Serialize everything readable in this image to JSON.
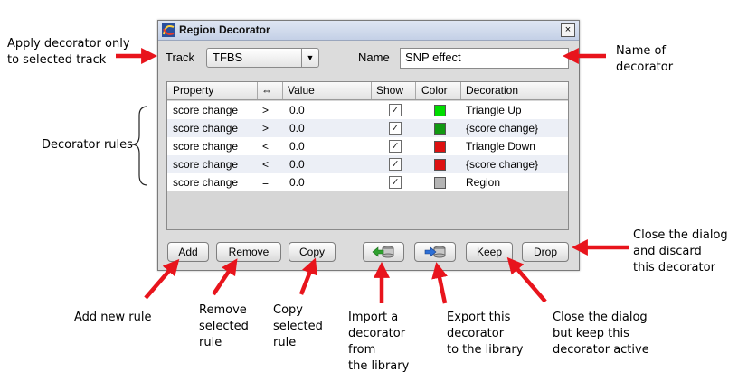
{
  "dialog": {
    "title": "Region Decorator",
    "close_glyph": "×",
    "track_label": "Track",
    "track_value": "TFBS",
    "name_label": "Name",
    "name_value": "SNP effect",
    "dropdown_glyph": "▼"
  },
  "table": {
    "headers": [
      "Property",
      "⇔",
      "Value",
      "Show",
      "Color",
      "Decoration"
    ],
    "rows": [
      {
        "property": "score change",
        "op": ">",
        "value": "0.0",
        "show": "✓",
        "color": "#00dd00",
        "decoration": "Triangle Up"
      },
      {
        "property": "score change",
        "op": ">",
        "value": "0.0",
        "show": "✓",
        "color": "#119911",
        "decoration": "{score change}"
      },
      {
        "property": "score change",
        "op": "<",
        "value": "0.0",
        "show": "✓",
        "color": "#dd1111",
        "decoration": "Triangle Down"
      },
      {
        "property": "score change",
        "op": "<",
        "value": "0.0",
        "show": "✓",
        "color": "#dd1111",
        "decoration": "{score change}"
      },
      {
        "property": "score change",
        "op": "=",
        "value": "0.0",
        "show": "✓",
        "color": "#b4b4b4",
        "decoration": "Region"
      }
    ]
  },
  "buttons": {
    "add": "Add",
    "remove": "Remove",
    "copy": "Copy",
    "import_icon": "import-from-library-icon",
    "export_icon": "export-to-library-icon",
    "keep": "Keep",
    "drop": "Drop"
  },
  "annotations": {
    "apply_decorator": "Apply decorator only\nto selected track",
    "name_of_decorator": "Name of\ndecorator",
    "decorator_rules": "Decorator rules",
    "close_discard": "Close the dialog\nand discard\nthis decorator",
    "add_rule": "Add new rule",
    "remove_rule": "Remove\nselected\nrule",
    "copy_rule": "Copy\nselected\nrule",
    "import": "Import  a\ndecorator\nfrom\nthe library",
    "export": "Export this\ndecorator\nto the library",
    "close_keep": "Close the dialog\nbut keep this\ndecorator active"
  },
  "colors": {
    "arrow": "#e8141c",
    "title_bar": "#c8d3e8",
    "dialog_bg": "#dcdcdc"
  }
}
